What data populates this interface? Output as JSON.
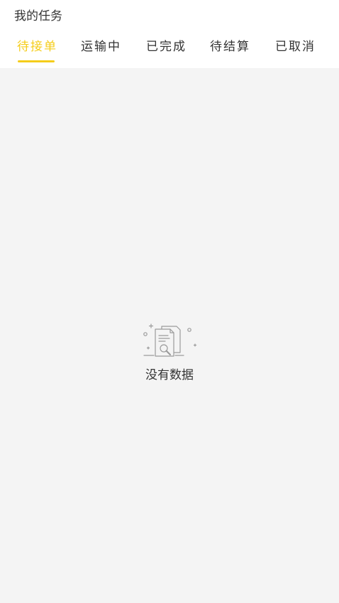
{
  "header": {
    "title": "我的任务"
  },
  "tabs": [
    {
      "label": "待接单",
      "active": true
    },
    {
      "label": "运输中",
      "active": false
    },
    {
      "label": "已完成",
      "active": false
    },
    {
      "label": "待结算",
      "active": false
    },
    {
      "label": "已取消",
      "active": false
    }
  ],
  "empty_state": {
    "icon": "empty-document-search-icon",
    "message": "没有数据"
  },
  "colors": {
    "accent": "#f5cd1b",
    "text": "#333333",
    "background": "#f4f4f4",
    "header_background": "#ffffff"
  }
}
